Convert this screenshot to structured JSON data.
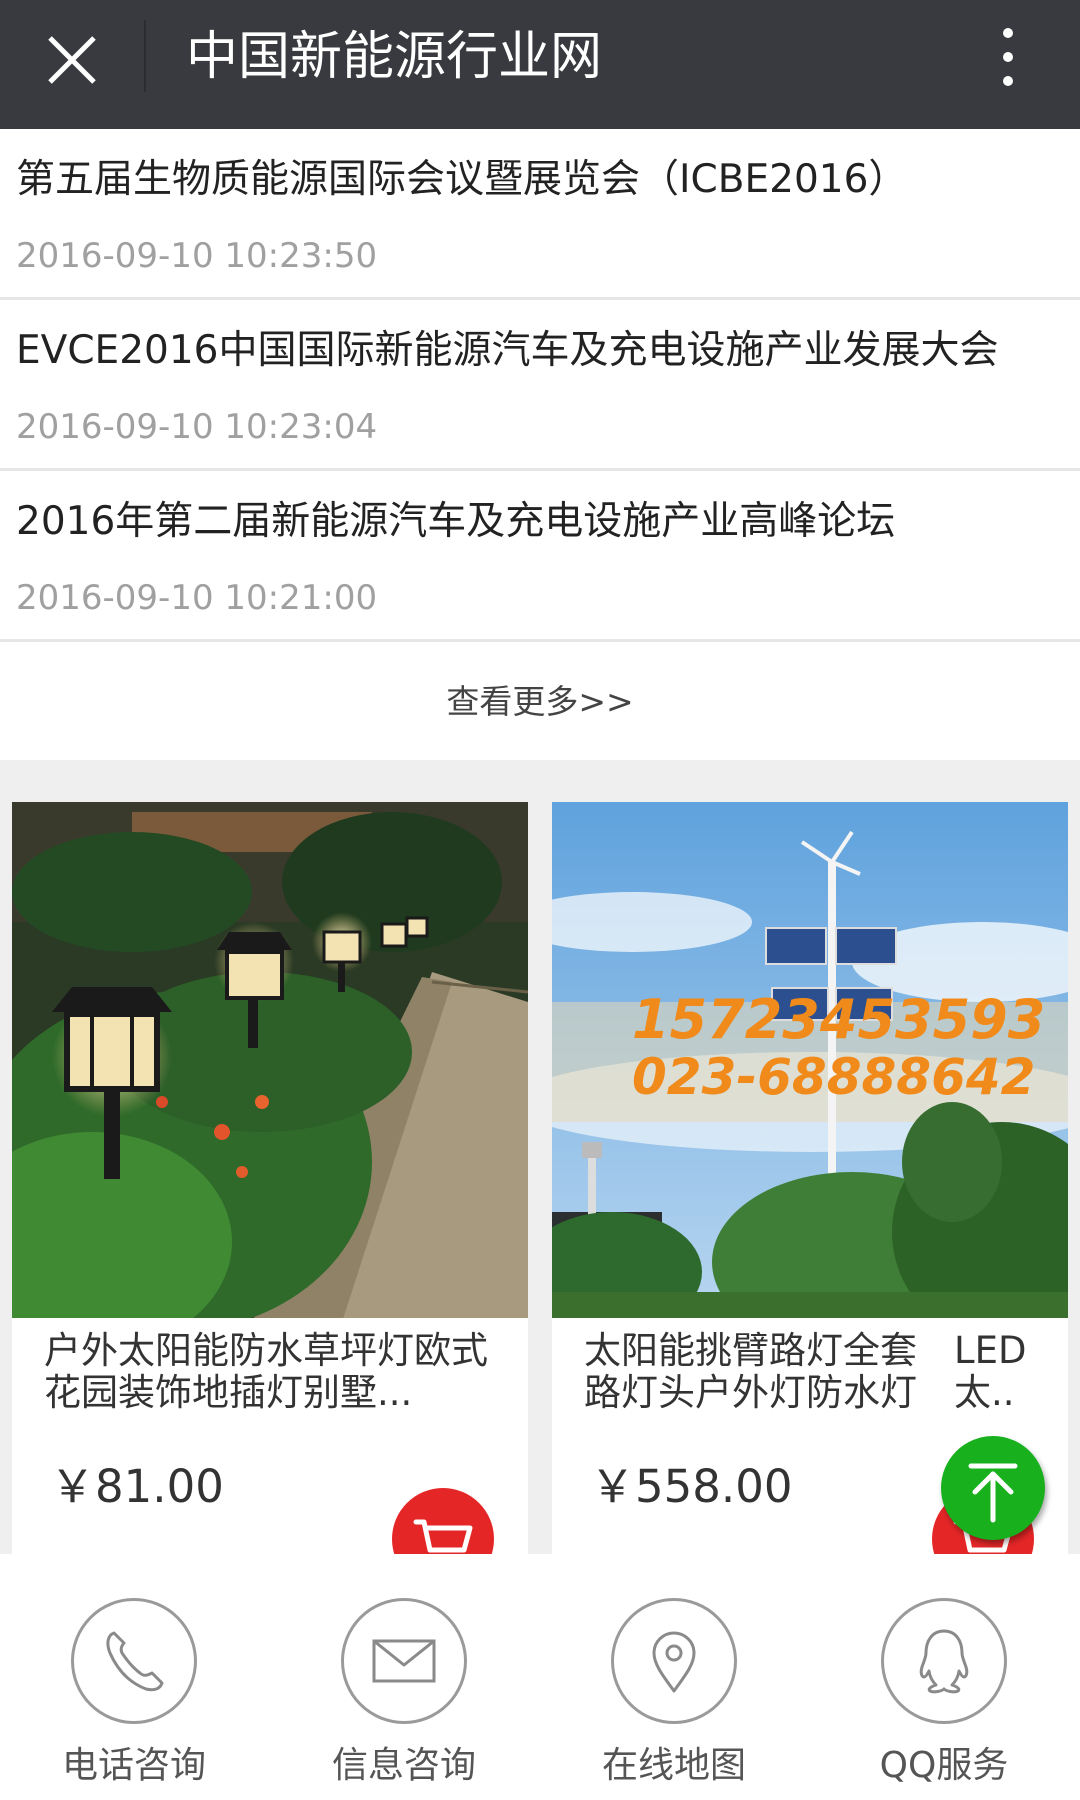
{
  "header": {
    "title": "中国新能源行业网",
    "close_icon": "close-icon",
    "menu_icon": "more-vertical-icon"
  },
  "news": [
    {
      "title": "第五届生物质能源国际会议暨展览会（ICBE2016）",
      "date": "2016-09-10 10:23:50"
    },
    {
      "title": "EVCE2016中国国际新能源汽车及充电设施产业发展大会",
      "date": "2016-09-10 10:23:04"
    },
    {
      "title": "2016年第二届新能源汽车及充电设施产业高峰论坛",
      "date": "2016-09-10 10:21:00"
    }
  ],
  "more_label": "查看更多>>",
  "products": [
    {
      "title": "户外太阳能防水草坪灯欧式花园装饰地插灯别墅...",
      "price": "￥81.00"
    },
    {
      "title": "太阳能挑臂路灯全套　LED路灯头户外灯防水灯　太..",
      "price": "￥558.00",
      "image_text": [
        "15723453593",
        "023-68888642"
      ]
    }
  ],
  "bottom_nav": [
    {
      "label": "电话咨询",
      "icon": "phone-icon"
    },
    {
      "label": "信息咨询",
      "icon": "mail-icon"
    },
    {
      "label": "在线地图",
      "icon": "location-pin-icon"
    },
    {
      "label": "QQ服务",
      "icon": "qq-icon"
    }
  ],
  "colors": {
    "header_bg": "#393a3f",
    "cart_red": "#e42627",
    "fab_green": "#18b01d"
  }
}
